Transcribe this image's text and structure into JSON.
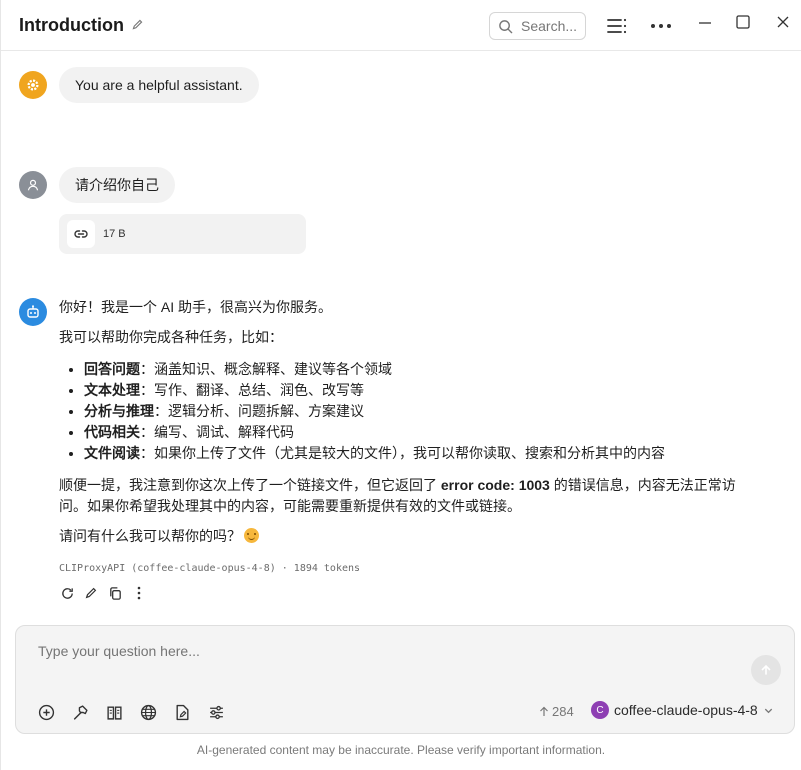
{
  "header": {
    "title": "Introduction",
    "search_placeholder": "Search..."
  },
  "colors": {
    "accent": "#1a5fd6",
    "system_avatar": "#f0a51f",
    "user_avatar": "#8a8f97",
    "assistant_avatar": "#2b8be0",
    "model_badge": "#8e3fb3"
  },
  "messages": {
    "system": {
      "text": "You are a helpful assistant."
    },
    "user": {
      "text": "请介绍你自己",
      "attachment_size": "17 B"
    },
    "assistant": {
      "greeting": "你好！我是一个 AI 助手，很高兴为你服务。",
      "intro": "我可以帮助你完成各种任务，比如：",
      "capabilities": [
        {
          "label": "回答问题",
          "text": "：涵盖知识、概念解释、建议等各个领域"
        },
        {
          "label": "文本处理",
          "text": "：写作、翻译、总结、润色、改写等"
        },
        {
          "label": "分析与推理",
          "text": "：逻辑分析、问题拆解、方案建议"
        },
        {
          "label": "代码相关",
          "text": "：编写、调试、解释代码"
        },
        {
          "label": "文件阅读",
          "text": "：如果你上传了文件（尤其是较大的文件），我可以帮你读取、搜索和分析其中的内容"
        }
      ],
      "note_before": "顺便一提，我注意到你这次上传了一个链接文件，但它返回了 ",
      "note_code": "error code: 1003",
      "note_after": " 的错误信息，内容无法正常访问。如果你希望我处理其中的内容，可能需要重新提供有效的文件或链接。",
      "closing": "请问有什么我可以帮你的吗？",
      "meta": "CLIProxyAPI (coffee-claude-opus-4-8) · 1894 tokens"
    }
  },
  "composer": {
    "placeholder": "Type your question here...",
    "token_count": "284",
    "model_initial": "C",
    "model_name": "coffee-claude-opus-4-8"
  },
  "footer": {
    "disclaimer": "AI-generated content may be inaccurate. Please verify important information."
  }
}
